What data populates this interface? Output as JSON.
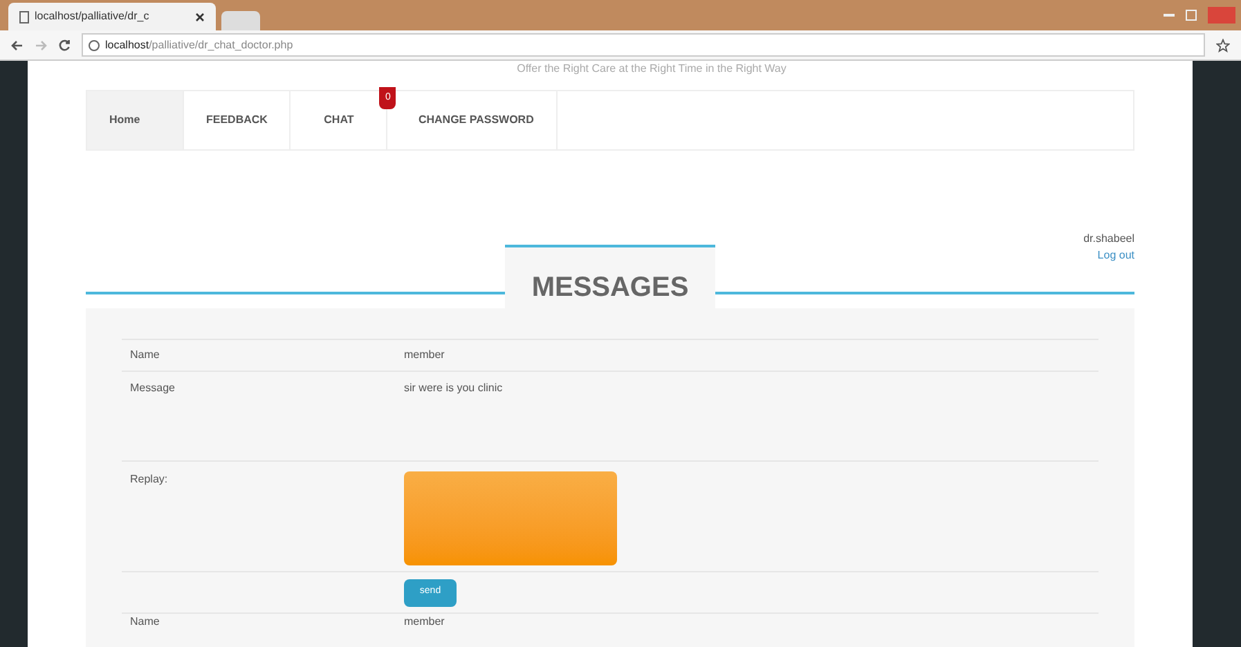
{
  "browser": {
    "tab_title": "localhost/palliative/dr_c",
    "address_host": "localhost",
    "address_path": "/palliative/dr_chat_doctor.php"
  },
  "tagline": "Offer the Right Care at the Right Time in the Right Way",
  "nav": [
    {
      "label": "Home",
      "selected": true
    },
    {
      "label": "FEEDBACK",
      "selected": false
    },
    {
      "label": "CHAT",
      "selected": false,
      "badge": "0"
    },
    {
      "label": "CHANGE PASSWORD",
      "selected": false
    }
  ],
  "user": {
    "name": "dr.shabeel",
    "logout": "Log out"
  },
  "heading": "MESSAGES",
  "messages": [
    {
      "name_label": "Name",
      "name": "member",
      "message_label": "Message",
      "message": "sir were is you clinic",
      "reply_label": "Replay:",
      "send": "send"
    }
  ],
  "next_row": {
    "label": "Name",
    "value": "member"
  }
}
